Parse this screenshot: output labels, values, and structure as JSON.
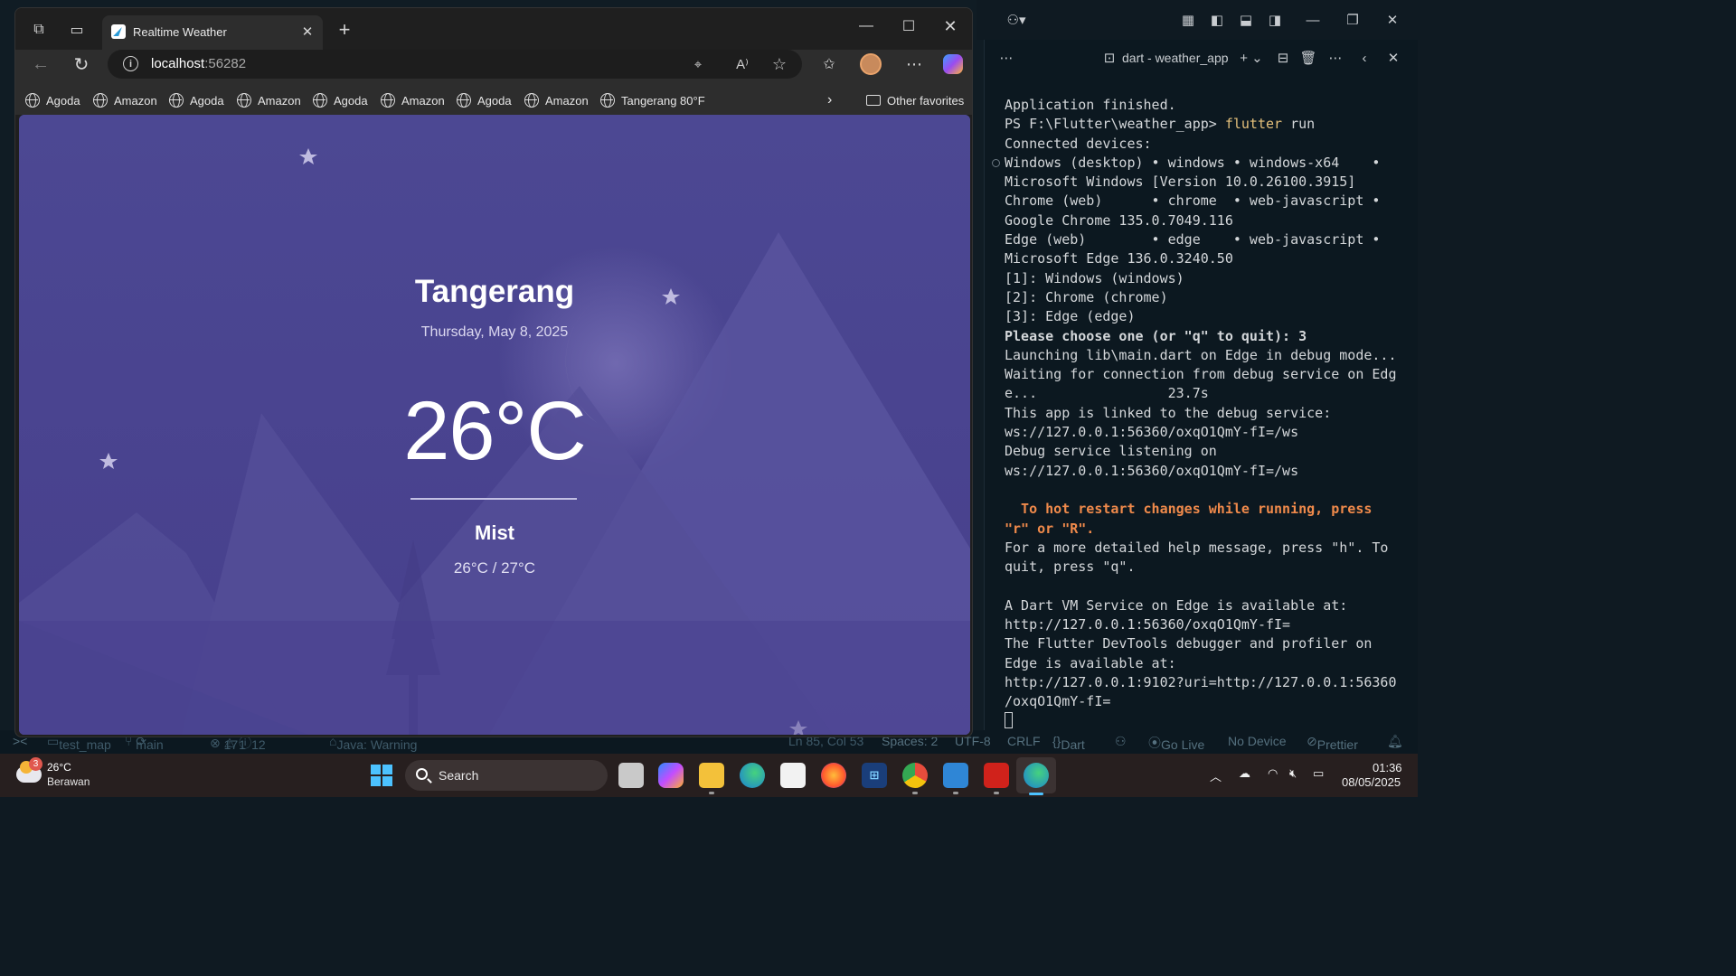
{
  "vscode": {
    "terminal_title": "dart - weather_app",
    "terminal_lines": [
      {
        "t": "Application finished.",
        "s": ""
      },
      {
        "t": "PS F:\\Flutter\\weather_app> flutter run",
        "s": "prompt"
      },
      {
        "t": "Connected devices:",
        "s": ""
      },
      {
        "t": "Windows (desktop) • windows • windows-x64    •",
        "s": ""
      },
      {
        "t": "Microsoft Windows [Version 10.0.26100.3915]",
        "s": ""
      },
      {
        "t": "Chrome (web)      • chrome  • web-javascript •",
        "s": ""
      },
      {
        "t": "Google Chrome 135.0.7049.116",
        "s": ""
      },
      {
        "t": "Edge (web)        • edge    • web-javascript •",
        "s": ""
      },
      {
        "t": "Microsoft Edge 136.0.3240.50",
        "s": ""
      },
      {
        "t": "[1]: Windows (windows)",
        "s": ""
      },
      {
        "t": "[2]: Chrome (chrome)",
        "s": ""
      },
      {
        "t": "[3]: Edge (edge)",
        "s": ""
      },
      {
        "t": "Please choose one (or \"q\" to quit): 3",
        "s": "choose"
      },
      {
        "t": "Launching lib\\main.dart on Edge in debug mode...",
        "s": ""
      },
      {
        "t": "Waiting for connection from debug service on Edg",
        "s": ""
      },
      {
        "t": "e...                23.7s",
        "s": ""
      },
      {
        "t": "This app is linked to the debug service:",
        "s": ""
      },
      {
        "t": "ws://127.0.0.1:56360/oxqO1QmY-fI=/ws",
        "s": ""
      },
      {
        "t": "Debug service listening on",
        "s": ""
      },
      {
        "t": "ws://127.0.0.1:56360/oxqO1QmY-fI=/ws",
        "s": ""
      },
      {
        "t": "",
        "s": "blank"
      },
      {
        "t": "  To hot restart changes while running, press",
        "s": "orange"
      },
      {
        "t": "\"r\" or \"R\".",
        "s": "orange"
      },
      {
        "t": "For a more detailed help message, press \"h\". To",
        "s": ""
      },
      {
        "t": "quit, press \"q\".",
        "s": ""
      },
      {
        "t": "",
        "s": "blank"
      },
      {
        "t": "A Dart VM Service on Edge is available at:",
        "s": ""
      },
      {
        "t": "http://127.0.0.1:56360/oxqO1QmY-fI=",
        "s": ""
      },
      {
        "t": "The Flutter DevTools debugger and profiler on",
        "s": ""
      },
      {
        "t": "Edge is available at:",
        "s": ""
      },
      {
        "t": "http://127.0.0.1:9102?uri=http://127.0.0.1:56360",
        "s": ""
      },
      {
        "t": "/oxqO1QmY-fI=",
        "s": ""
      }
    ],
    "status": {
      "project": "test_map",
      "branch": "main",
      "errors": "17",
      "warnings": "1",
      "info": "12",
      "java": "Java: Warning",
      "position": "Ln 85, Col 53",
      "spaces": "Spaces: 2",
      "encoding": "UTF-8",
      "eol": "CRLF",
      "language": "Dart",
      "golive": "Go Live",
      "device": "No Device",
      "prettier": "Prettier"
    }
  },
  "browser": {
    "tab_title": "Realtime Weather",
    "url_host": "localhost",
    "url_port": ":56282",
    "favorites": [
      "Agoda",
      "Amazon",
      "Agoda",
      "Amazon",
      "Agoda",
      "Amazon",
      "Agoda",
      "Amazon",
      "Tangerang 80°F"
    ],
    "other_favorites": "Other favorites"
  },
  "weather": {
    "city": "Tangerang",
    "date": "Thursday, May 8, 2025",
    "temperature": "26°C",
    "condition": "Mist",
    "range": "26°C / 27°C",
    "colors": {
      "sky": "#4b478f",
      "mountain": "#5a549f",
      "moon": "#c9c9cf"
    }
  },
  "taskbar": {
    "weather_temp": "26°C",
    "weather_desc": "Berawan",
    "weather_badge": "3",
    "search_label": "Search",
    "time": "01:36",
    "date": "08/05/2025"
  }
}
